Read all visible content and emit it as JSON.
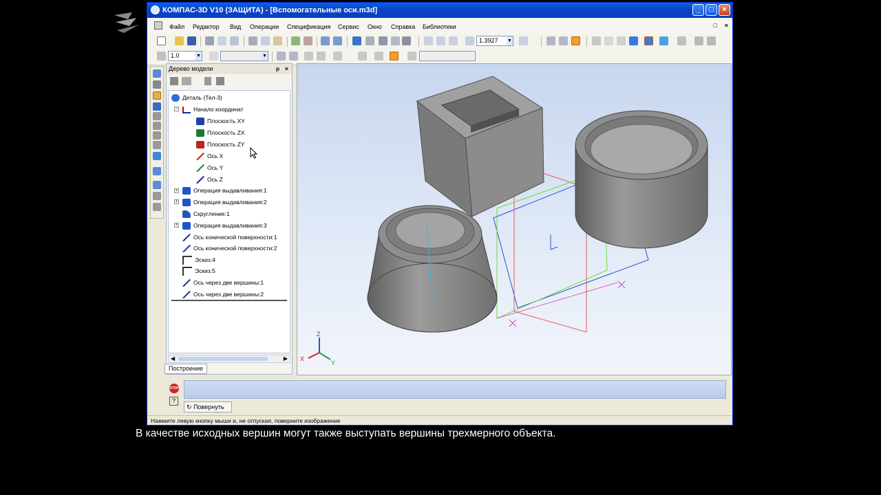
{
  "window": {
    "title": "КОМПАС-3D V10 (ЗАЩИТА) - [Вспомогательные оси.m3d]"
  },
  "menu": [
    "Файл",
    "Редактор",
    "Вид",
    "Операции",
    "Спецификация",
    "Сервис",
    "Окно",
    "Справка",
    "Библиотеки"
  ],
  "toolbar": {
    "zoom_value": "1.3927",
    "step_value": "1.0"
  },
  "tree": {
    "title": "Дерево модели",
    "root": "Деталь (Тел-3)",
    "items": [
      {
        "label": "Начало координат"
      },
      {
        "label": "Плоскость XY"
      },
      {
        "label": "Плоскость ZX"
      },
      {
        "label": "Плоскость ZY"
      },
      {
        "label": "Ось X"
      },
      {
        "label": "Ось Y"
      },
      {
        "label": "Ось Z"
      },
      {
        "label": "Операция выдавливания:1"
      },
      {
        "label": "Операция выдавливания:2"
      },
      {
        "label": "Скругление:1"
      },
      {
        "label": "Операция выдавливания:3"
      },
      {
        "label": "Ось конической поверхности:1"
      },
      {
        "label": "Ось конической поверхности:2"
      },
      {
        "label": "Эскиз:4"
      },
      {
        "label": "Эскиз:5"
      },
      {
        "label": "Ось через две вершины:1"
      },
      {
        "label": "Ось через две вершины:2"
      }
    ],
    "tab": "Построение"
  },
  "axes": {
    "z": "Z",
    "x": "X",
    "y": "Y"
  },
  "panel": {
    "rotate_button": "Повернуть"
  },
  "status": "Нажмите левую кнопку мыши и, не отпуская, поверните изображение",
  "caption": "В качестве исходных вершин могут также выступать вершины трехмерного объекта.",
  "colors": {
    "titlebar": "#0846c8",
    "viewport_top": "#c7d6ef",
    "solid": "#8a8a8a"
  }
}
